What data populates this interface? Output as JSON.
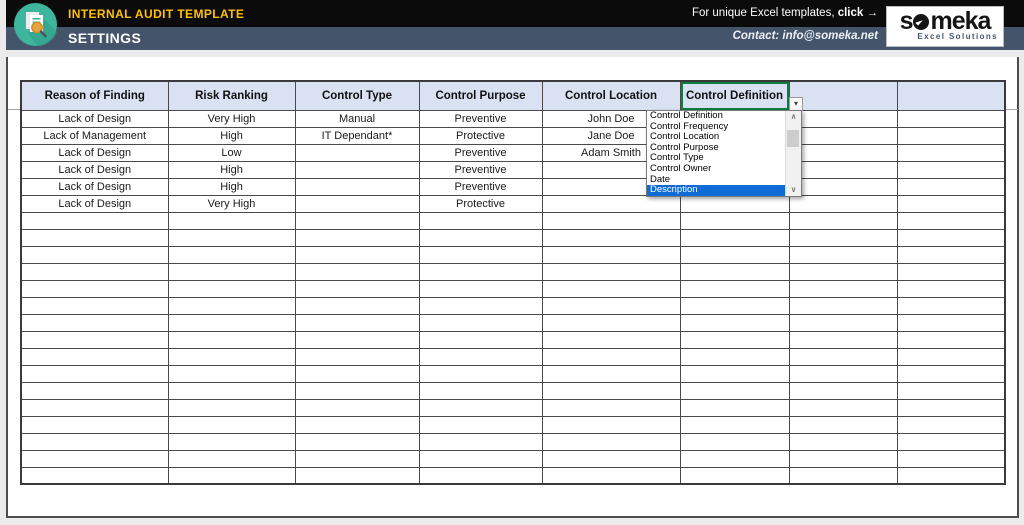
{
  "header": {
    "title": "INTERNAL AUDIT TEMPLATE",
    "subtitle": "SETTINGS",
    "promo_text": "For unique Excel templates, ",
    "promo_link": "click",
    "promo_arrow": "→",
    "contact": "Contact: info@someka.net",
    "logo": {
      "brand": "someka",
      "tagline": "Excel Solutions"
    },
    "icon_name": "audit-document-magnifier-icon"
  },
  "table": {
    "headers": [
      "Reason of Finding",
      "Risk Ranking",
      "Control Type",
      "Control Purpose",
      "Control Location",
      "Control Definition",
      "",
      ""
    ],
    "selected_header_index": 5,
    "rows": [
      [
        "Lack of Design",
        "Very High",
        "Manual",
        "Preventive",
        "John Doe",
        "",
        "",
        ""
      ],
      [
        "Lack of Management",
        "High",
        "IT Dependant*",
        "Protective",
        "Jane Doe",
        "",
        "",
        ""
      ],
      [
        "Lack of Design",
        "Low",
        "",
        "Preventive",
        "Adam Smith",
        "",
        "",
        ""
      ],
      [
        "Lack of Design",
        "High",
        "",
        "Preventive",
        "",
        "",
        "",
        ""
      ],
      [
        "Lack of Design",
        "High",
        "",
        "Preventive",
        "",
        "",
        "",
        ""
      ],
      [
        "Lack of Design",
        "Very High",
        "",
        "Protective",
        "",
        "",
        "",
        ""
      ]
    ],
    "empty_row_count": 16,
    "columns_count": 8
  },
  "dropdown": {
    "arrow_glyph": "▾",
    "items": [
      "Control Definition",
      "Control Frequency",
      "Control Location",
      "Control Purpose",
      "Control Type",
      "Control Owner",
      "Date",
      "Description"
    ],
    "selected_index": 7,
    "scroll_up_glyph": "∧",
    "scroll_down_glyph": "∨"
  },
  "colors": {
    "top_bar": "#0b0b0b",
    "slate_bar": "#44546a",
    "accent_yellow": "#ffc000",
    "header_fill": "#d9e1f2",
    "selection_green": "#107c41",
    "dropdown_highlight": "#0f6bd6",
    "icon_teal": "#3db69d"
  }
}
